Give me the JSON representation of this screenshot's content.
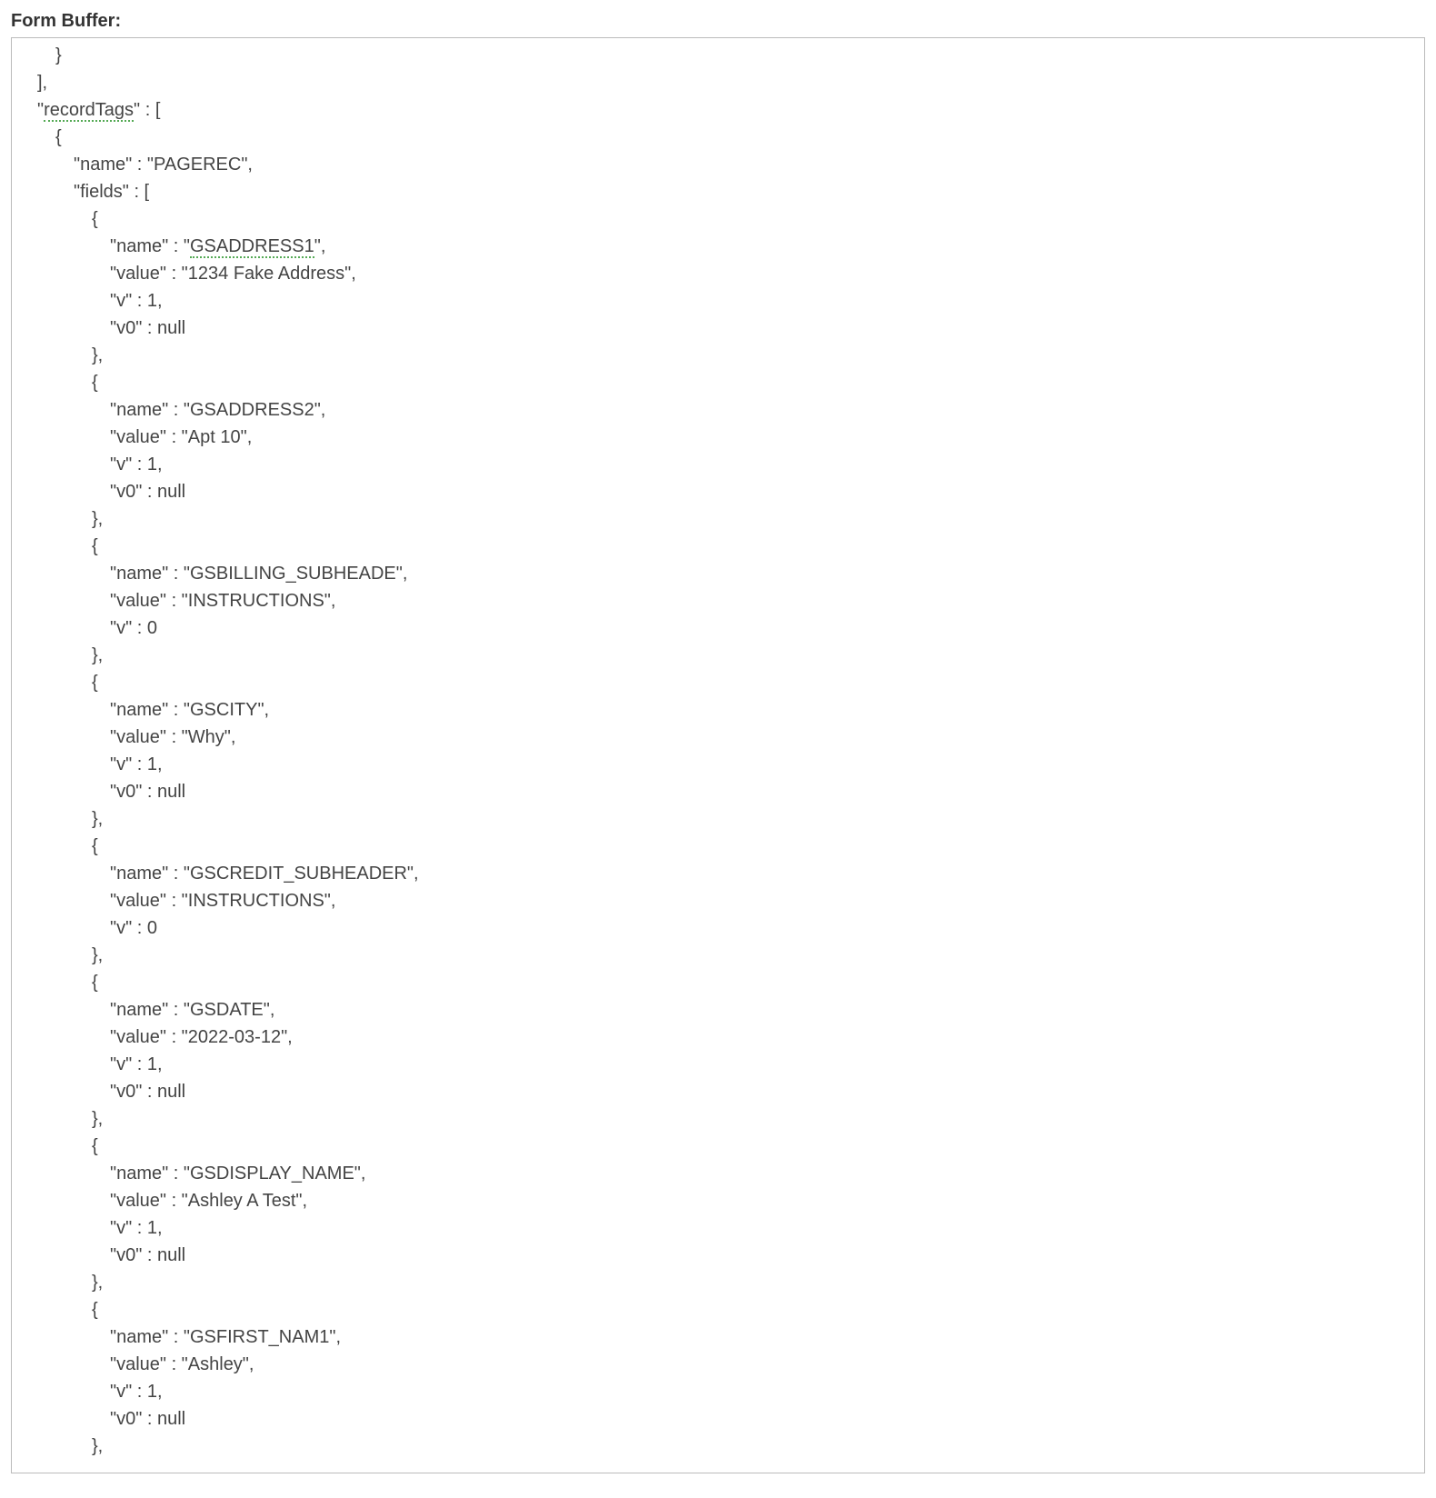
{
  "header": "Form Buffer:",
  "json_content": {
    "prefix_lines": [
      {
        "indent": 4,
        "text": "}"
      },
      {
        "indent": 2,
        "text": "],"
      }
    ],
    "recordTags_key": "recordTags",
    "records": [
      {
        "name": "PAGEREC",
        "fields": [
          {
            "name": "GSADDRESS1",
            "value": "1234 Fake Address",
            "v": 1,
            "v0": "null",
            "underline_name": true
          },
          {
            "name": "GSADDRESS2",
            "value": "Apt 10",
            "v": 1,
            "v0": "null",
            "underline_name": false
          },
          {
            "name": "GSBILLING_SUBHEADE",
            "value": "INSTRUCTIONS",
            "v": 0,
            "underline_name": false
          },
          {
            "name": "GSCITY",
            "value": "Why",
            "v": 1,
            "v0": "null",
            "underline_name": false
          },
          {
            "name": "GSCREDIT_SUBHEADER",
            "value": "INSTRUCTIONS",
            "v": 0,
            "underline_name": false
          },
          {
            "name": "GSDATE",
            "value": "2022-03-12",
            "v": 1,
            "v0": "null",
            "underline_name": false
          },
          {
            "name": "GSDISPLAY_NAME",
            "value": "Ashley A Test",
            "v": 1,
            "v0": "null",
            "underline_name": false
          },
          {
            "name": "GSFIRST_NAM1",
            "value": "Ashley",
            "v": 1,
            "v0": "null",
            "underline_name": false
          }
        ]
      }
    ]
  }
}
